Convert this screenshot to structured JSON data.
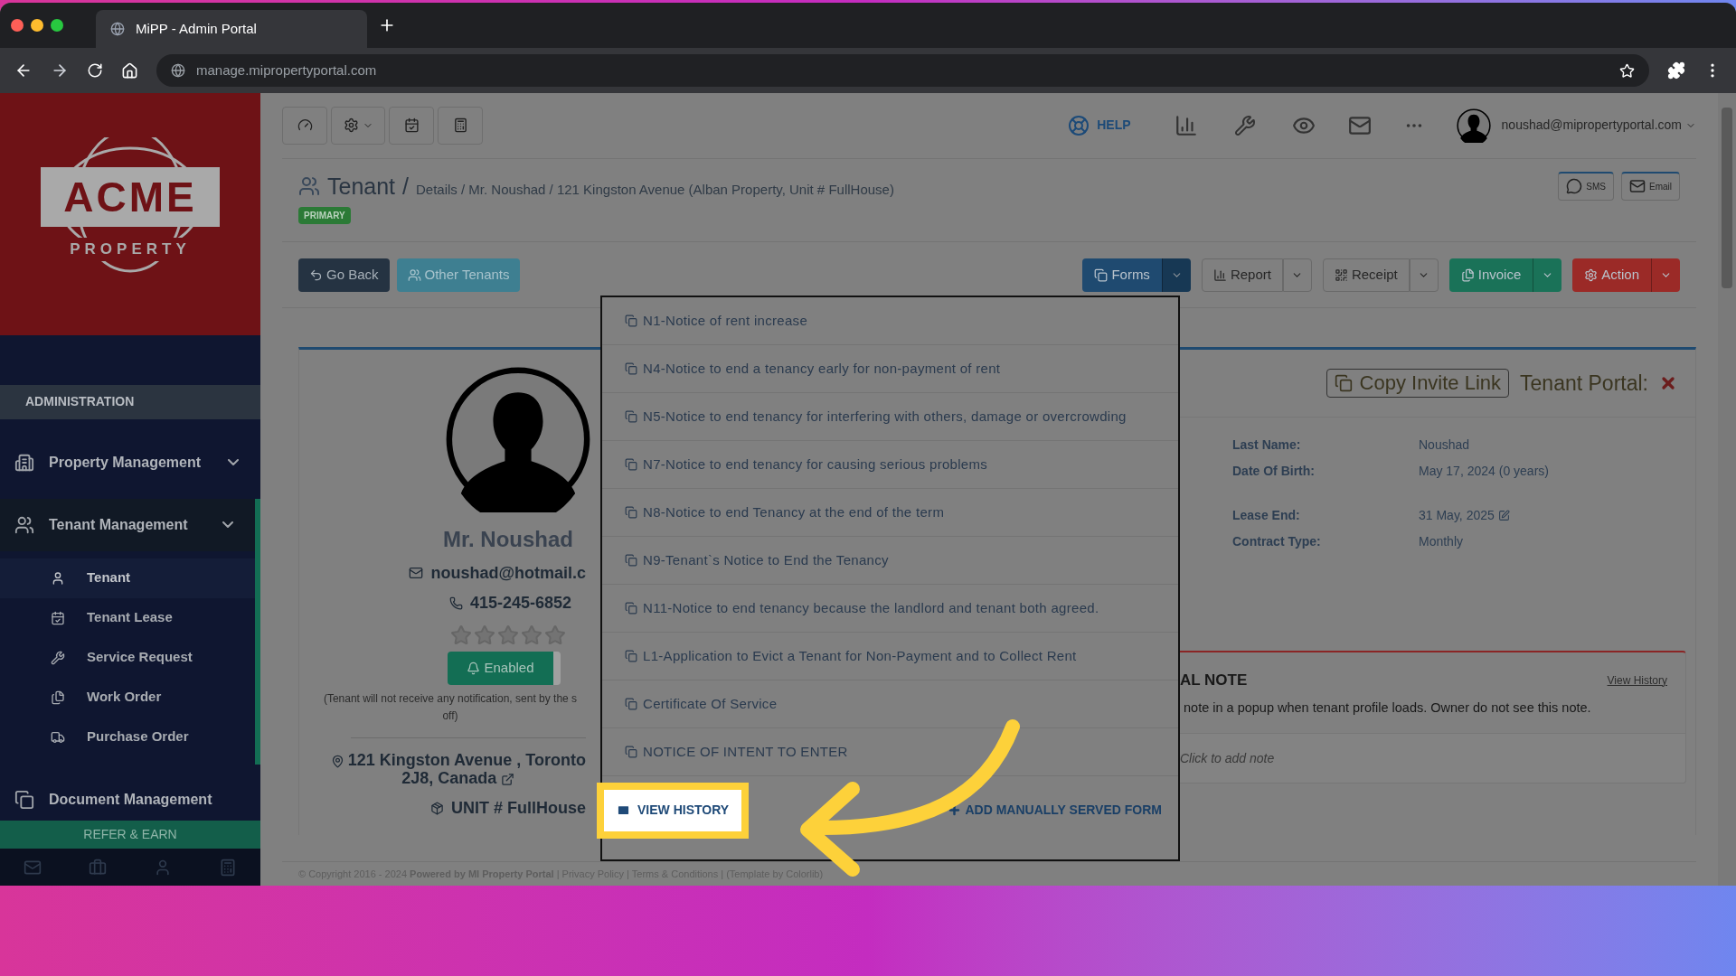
{
  "browser": {
    "tab_title": "MiPP - Admin Portal",
    "url": "manage.mipropertyportal.com"
  },
  "logo": {
    "name": "ACME",
    "sub": "PROPERTY"
  },
  "sidebar": {
    "section": "ADMINISTRATION",
    "groups": [
      {
        "label": "Property Management",
        "expanded": false
      },
      {
        "label": "Tenant Management",
        "expanded": true,
        "children": [
          {
            "label": "Tenant",
            "selected": true
          },
          {
            "label": "Tenant Lease",
            "selected": false
          },
          {
            "label": "Service Request",
            "selected": false
          },
          {
            "label": "Work Order",
            "selected": false
          },
          {
            "label": "Purchase Order",
            "selected": false
          }
        ]
      },
      {
        "label": "Document Management",
        "expanded": false
      }
    ],
    "refer": "REFER & EARN"
  },
  "topbar": {
    "help": "HELP",
    "user": "noushad@mipropertyportal.com"
  },
  "header": {
    "title": "Tenant",
    "separator": "/",
    "breadcrumb": "Details / Mr. Noushad / 121 Kingston Avenue (Alban Property, Unit # FullHouse)",
    "badge": "PRIMARY",
    "sms": "SMS",
    "email": "Email"
  },
  "actions": {
    "go_back": "Go Back",
    "other_tenants": "Other Tenants",
    "groups": [
      {
        "label": "Forms",
        "kind": "forms",
        "color": "#1f4a70"
      },
      {
        "label": "Report",
        "kind": "report",
        "color": "#808080"
      },
      {
        "label": "Receipt",
        "kind": "receipt",
        "color": "#808080"
      },
      {
        "label": "Invoice",
        "kind": "invoice",
        "color": "#1a7258"
      },
      {
        "label": "Action",
        "kind": "action",
        "color": "#9b2a27"
      }
    ]
  },
  "profile": {
    "name": "Mr. Noushad",
    "email": "noushad@hotmail.c",
    "phone": "415-245-6852",
    "stars": 0,
    "notify": {
      "label": "Enabled",
      "on": true
    },
    "notice": [
      "(Tenant will not receive any notification, sent by the s",
      "off)"
    ],
    "address": [
      "121 Kingston Avenue , Toronto",
      "2J8, Canada"
    ],
    "unit": "UNIT # FullHouse"
  },
  "forms_menu": {
    "items": [
      "N1-Notice of rent increase",
      "N4-Notice to end a tenancy early for non-payment of rent",
      "N5-Notice to end tenancy for interfering with others, damage or overcrowding",
      "N7-Notice to end tenancy for causing serious problems",
      "N8-Notice to end Tenancy at the end of the term",
      "N9-Tenant`s Notice to End the Tenancy",
      "N11-Notice to end tenancy because the landlord and tenant both agreed.",
      "L1-Application to Evict a Tenant for Non-Payment and to Collect Rent",
      "Certificate Of Service",
      "NOTICE OF INTENT TO ENTER"
    ],
    "view_history": "VIEW HISTORY",
    "add_form": "ADD MANUALLY SERVED FORM"
  },
  "details": {
    "copy_invite": "Copy Invite Link",
    "portal_label": "Tenant Portal:",
    "fields": [
      {
        "label": "Last Name:",
        "value": "Noushad"
      },
      {
        "label": "Date Of Birth:",
        "value": "May 17, 2024 (0 years)"
      },
      {
        "label": "Lease End:",
        "value": "31 May, 2025"
      },
      {
        "label": "Contract Type:",
        "value": "Monthly"
      }
    ]
  },
  "note": {
    "title": "AL NOTE",
    "history": "View History",
    "text": "note in a popup when tenant profile loads. Owner do not see this note.",
    "placeholder": "Click to add note"
  },
  "footer": "© Copyright 2016 - 2024 **Powered by MI Property Portal** | Privacy Policy | Terms & Conditions | (Template by Colorlib)"
}
